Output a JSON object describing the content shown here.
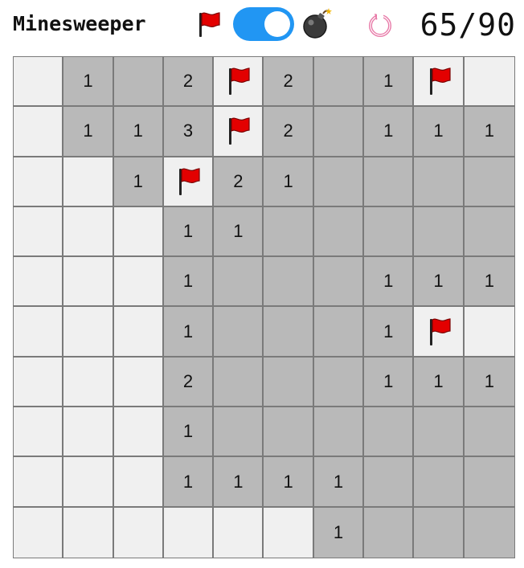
{
  "header": {
    "title": "Minesweeper",
    "counter": "65/90",
    "toggle_on": true,
    "icons": {
      "flag_mode": "flag-icon",
      "bomb_mode": "bomb-icon",
      "reset": "refresh-icon"
    }
  },
  "colors": {
    "unrevealed": "#f0f0f0",
    "revealed": "#b9b9b9",
    "grid_line": "#7a7a7a",
    "flag_red": "#e30000",
    "toggle_track": "#2196f3",
    "reset_pink": "#e87aa8"
  },
  "board": {
    "rows": 10,
    "cols": 10,
    "legend": {
      "U": "unrevealed",
      "F": "flag",
      "E": "revealed-empty",
      "1-8": "revealed-number"
    },
    "cells": [
      [
        "U",
        "1",
        "E",
        "2",
        "F",
        "2",
        "E",
        "1",
        "F",
        "U"
      ],
      [
        "U",
        "1",
        "1",
        "3",
        "F",
        "2",
        "E",
        "1",
        "1",
        "1"
      ],
      [
        "U",
        "U",
        "1",
        "F",
        "2",
        "1",
        "E",
        "E",
        "E",
        "E"
      ],
      [
        "U",
        "U",
        "U",
        "1",
        "1",
        "E",
        "E",
        "E",
        "E",
        "E"
      ],
      [
        "U",
        "U",
        "U",
        "1",
        "E",
        "E",
        "E",
        "1",
        "1",
        "1"
      ],
      [
        "U",
        "U",
        "U",
        "1",
        "E",
        "E",
        "E",
        "1",
        "F",
        "U"
      ],
      [
        "U",
        "U",
        "U",
        "2",
        "E",
        "E",
        "E",
        "1",
        "1",
        "1"
      ],
      [
        "U",
        "U",
        "U",
        "1",
        "E",
        "E",
        "E",
        "E",
        "E",
        "E"
      ],
      [
        "U",
        "U",
        "U",
        "1",
        "1",
        "1",
        "1",
        "E",
        "E",
        "E"
      ],
      [
        "U",
        "U",
        "U",
        "U",
        "U",
        "U",
        "1",
        "E",
        "E",
        "E"
      ]
    ]
  }
}
